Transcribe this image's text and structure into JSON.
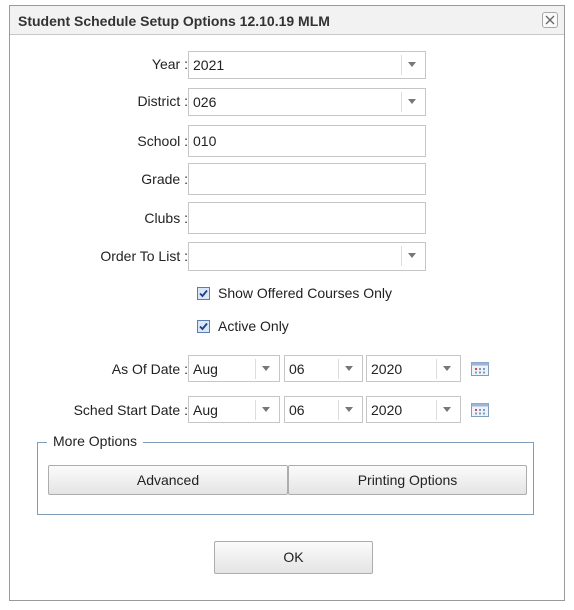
{
  "dialog": {
    "title": "Student Schedule Setup Options 12.10.19 MLM"
  },
  "form": {
    "year": {
      "label": "Year :",
      "value": "2021"
    },
    "district": {
      "label": "District :",
      "value": "026"
    },
    "school": {
      "label": "School :",
      "value": "010"
    },
    "grade": {
      "label": "Grade :",
      "value": ""
    },
    "clubs": {
      "label": "Clubs :",
      "value": ""
    },
    "order_to_list": {
      "label": "Order To List :",
      "value": ""
    },
    "show_offered": {
      "label": "Show Offered Courses Only",
      "checked": true
    },
    "active_only": {
      "label": "Active Only",
      "checked": true
    },
    "as_of_date": {
      "label": "As Of Date :",
      "month": "Aug",
      "day": "06",
      "year": "2020"
    },
    "sched_start_date": {
      "label": "Sched Start Date :",
      "month": "Aug",
      "day": "06",
      "year": "2020"
    }
  },
  "more_options": {
    "legend": "More Options",
    "advanced_label": "Advanced",
    "printing_label": "Printing Options"
  },
  "ok_label": "OK",
  "icons": {
    "close": "close-icon",
    "dropdown": "chevron-down-icon",
    "calendar": "calendar-icon",
    "checkbox": "check-icon"
  },
  "colors": {
    "border": "#9a9a9a",
    "fieldset_border": "#7f9db9",
    "checkbox_fill": "#dbe6f6"
  }
}
